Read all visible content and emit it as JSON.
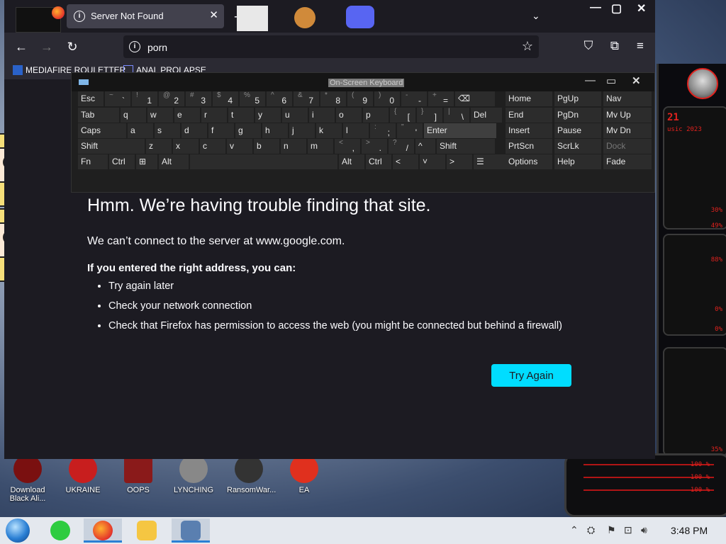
{
  "firefox": {
    "tab_title": "Server Not Found",
    "url": "porn",
    "bookmarks": [
      {
        "label": "MEDIAFIRE ROULETTER",
        "icon": "mediafire-icon"
      },
      {
        "label": "ANAL PROLAPSE",
        "icon": "bookmark-icon"
      }
    ],
    "error": {
      "title": "Hmm. We’re having trouble finding that site.",
      "message": "We can’t connect to the server at www.google.com.",
      "subheading": "If you entered the right address, you can:",
      "suggestions": [
        "Try again later",
        "Check your network connection",
        "Check that Firefox has permission to access the web (you might be connected but behind a firewall)"
      ],
      "button": "Try Again"
    },
    "accent": "#00ddff"
  },
  "osk": {
    "title": "On-Screen Keyboard",
    "rows": [
      [
        "Esc",
        "~ `",
        "! 1",
        "@ 2",
        "# 3",
        "$ 4",
        "% 5",
        "^ 6",
        "& 7",
        "* 8",
        "( 9",
        ") 0",
        "- -",
        "+ =",
        "⌫"
      ],
      [
        "Tab",
        "q",
        "w",
        "e",
        "r",
        "t",
        "y",
        "u",
        "i",
        "o",
        "p",
        "{ [",
        "} ]",
        "| \\",
        "Del"
      ],
      [
        "Caps",
        "a",
        "s",
        "d",
        "f",
        "g",
        "h",
        "j",
        "k",
        "l",
        ": ;",
        "\" '",
        "Enter"
      ],
      [
        "Shift",
        "z",
        "x",
        "c",
        "v",
        "b",
        "n",
        "m",
        "< ,",
        "> .",
        "? /",
        "^",
        "Shift"
      ],
      [
        "Fn",
        "Ctrl",
        "⊞",
        "Alt",
        "",
        "Alt",
        "Ctrl",
        "<",
        "˅",
        ">",
        "☰"
      ]
    ],
    "nav_keys": [
      [
        "Home",
        "PgUp",
        "Nav"
      ],
      [
        "End",
        "PgDn",
        "Mv Up"
      ],
      [
        "Insert",
        "Pause",
        "Mv Dn"
      ],
      [
        "PrtScn",
        "ScrLk",
        "Dock"
      ],
      [
        "Options",
        "Help",
        "Fade"
      ]
    ]
  },
  "desktop_icons": [
    {
      "label": "Download Black Ali...",
      "color": "#7a1010"
    },
    {
      "label": "UKRAINE",
      "color": "#c81e1e"
    },
    {
      "label": "OOPS",
      "color": "#8a1a1a"
    },
    {
      "label": "LYNCHING",
      "color": "#888888"
    },
    {
      "label": "RansomWar...",
      "color": "#333333"
    },
    {
      "label": "EA",
      "color": "#e0301e"
    }
  ],
  "gauge": {
    "values": [
      "30%",
      "49%",
      "88%",
      "0%",
      "0%",
      "35%"
    ],
    "header": "usic 2023",
    "bottom_values": [
      "100 %",
      "100 %",
      "100 %"
    ]
  },
  "taskbar": {
    "time": "3:48 PM"
  }
}
